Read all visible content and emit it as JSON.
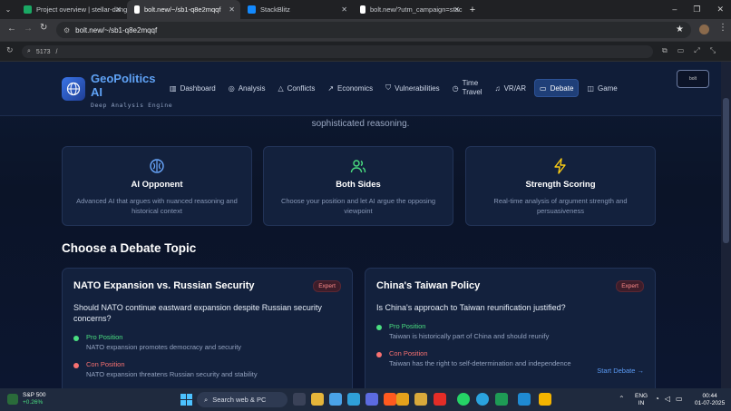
{
  "browser": {
    "tabs": [
      {
        "title": "Project overview | stellar-dange",
        "color": "#1aa864",
        "active": false
      },
      {
        "title": "bolt.new/~/sb1-q8e2mqqf",
        "color": "#ffffff",
        "active": true
      },
      {
        "title": "StackBlitz",
        "color": "#1389fd",
        "active": false
      },
      {
        "title": "bolt.new/?utm_campaign=stac",
        "color": "#ffffff",
        "active": false
      }
    ],
    "new_tab": "+",
    "address": "bolt.new/~/sb1-q8e2mqqf",
    "devtools_port": "5173",
    "devtools_path": "/"
  },
  "app": {
    "brand_line1": "GeoPolitics",
    "brand_line2": "AI",
    "tagline": "Deep Analysis Engine",
    "nav": [
      {
        "label": "Dashboard",
        "icon": "bar-chart-icon"
      },
      {
        "label": "Analysis",
        "icon": "brain-icon"
      },
      {
        "label": "Conflicts",
        "icon": "warning-triangle-icon"
      },
      {
        "label": "Economics",
        "icon": "trending-up-icon"
      },
      {
        "label": "Vulnerabilities",
        "icon": "shield-icon"
      },
      {
        "label": "Time\nTravel",
        "icon": "clock-icon"
      },
      {
        "label": "VR/AR",
        "icon": "headphones-icon"
      },
      {
        "label": "Debate",
        "icon": "message-icon"
      },
      {
        "label": "Game",
        "icon": "gamepad-icon"
      }
    ],
    "active_nav": "Debate",
    "avatar_text": "bolt",
    "intro_text": "sophisticated reasoning.",
    "features": [
      {
        "title": "AI Opponent",
        "desc": "Advanced AI that argues with nuanced reasoning and historical context",
        "icon": "brain-icon",
        "color": "#6aa8ff"
      },
      {
        "title": "Both Sides",
        "desc": "Choose your position and let AI argue the opposing viewpoint",
        "icon": "users-icon",
        "color": "#4ade80"
      },
      {
        "title": "Strength Scoring",
        "desc": "Real-time analysis of argument strength and persuasiveness",
        "icon": "lightning-icon",
        "color": "#facc15"
      }
    ],
    "section_title": "Choose a Debate Topic",
    "topics": [
      {
        "title": "NATO Expansion vs. Russian Security",
        "badge": "Expert",
        "question": "Should NATO continue eastward expansion despite Russian security concerns?",
        "pro_label": "Pro Position",
        "pro_text": "NATO expansion promotes democracy and security",
        "con_label": "Con Position",
        "con_text": "NATO expansion threatens Russian security and stability",
        "cta": ""
      },
      {
        "title": "China's Taiwan Policy",
        "badge": "Expert",
        "question": "Is China's approach to Taiwan reunification justified?",
        "pro_label": "Pro Position",
        "pro_text": "Taiwan is historically part of China and should reunify",
        "con_label": "Con Position",
        "con_text": "Taiwan has the right to self-determination and independence",
        "cta": "Start Debate"
      }
    ],
    "colors": {
      "pro": "#4ade80",
      "con": "#f87171",
      "accent": "#5b9bf5"
    }
  },
  "taskbar": {
    "stock_name": "S&P 500",
    "stock_change": "+0.26%",
    "search_placeholder": "Search web & PC",
    "lang": "ENG",
    "region": "IN",
    "time": "00:44",
    "date": "01-07-2025"
  }
}
